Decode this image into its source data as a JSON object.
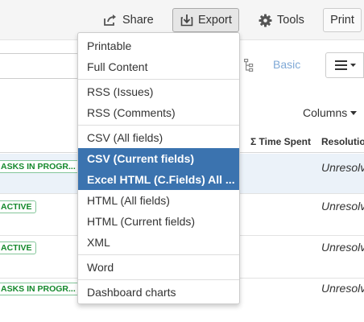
{
  "toolbar": {
    "share": "Share",
    "export": "Export",
    "tools": "Tools",
    "print": "Print",
    "share_icon": "share-icon",
    "export_icon": "export-icon",
    "tools_icon": "gear-icon"
  },
  "search_bar": {
    "basic": "Basic",
    "menu_icon": "hamburger-icon"
  },
  "table": {
    "columns_button": "Columns",
    "headers": {
      "time_spent": "Σ Time Spent",
      "resolution": "Resolutio"
    },
    "rows": [
      {
        "status": "ASKS IN PROGR...",
        "resolution": "Unresolv"
      },
      {
        "status": "ACTIVE",
        "resolution": "Unresolv"
      },
      {
        "status": "ACTIVE",
        "resolution": "Unresolv"
      },
      {
        "status": "ASKS IN PROGR...",
        "resolution": "Unresolv"
      }
    ]
  },
  "export_menu": {
    "items": [
      "Printable",
      "Full Content",
      "RSS (Issues)",
      "RSS (Comments)",
      "CSV (All fields)",
      "CSV (Current fields)",
      "Excel HTML (C.Fields) All ...",
      "HTML (All fields)",
      "HTML (Current fields)",
      "XML",
      "Word",
      "Dashboard charts"
    ],
    "highlighted": [
      "CSV (Current fields)",
      "Excel HTML (C.Fields) All ..."
    ]
  },
  "colors": {
    "highlight": "#3b73af",
    "status_green": "#14892c",
    "link": "#7ea8d6",
    "row_highlight": "#ebf2f9"
  }
}
